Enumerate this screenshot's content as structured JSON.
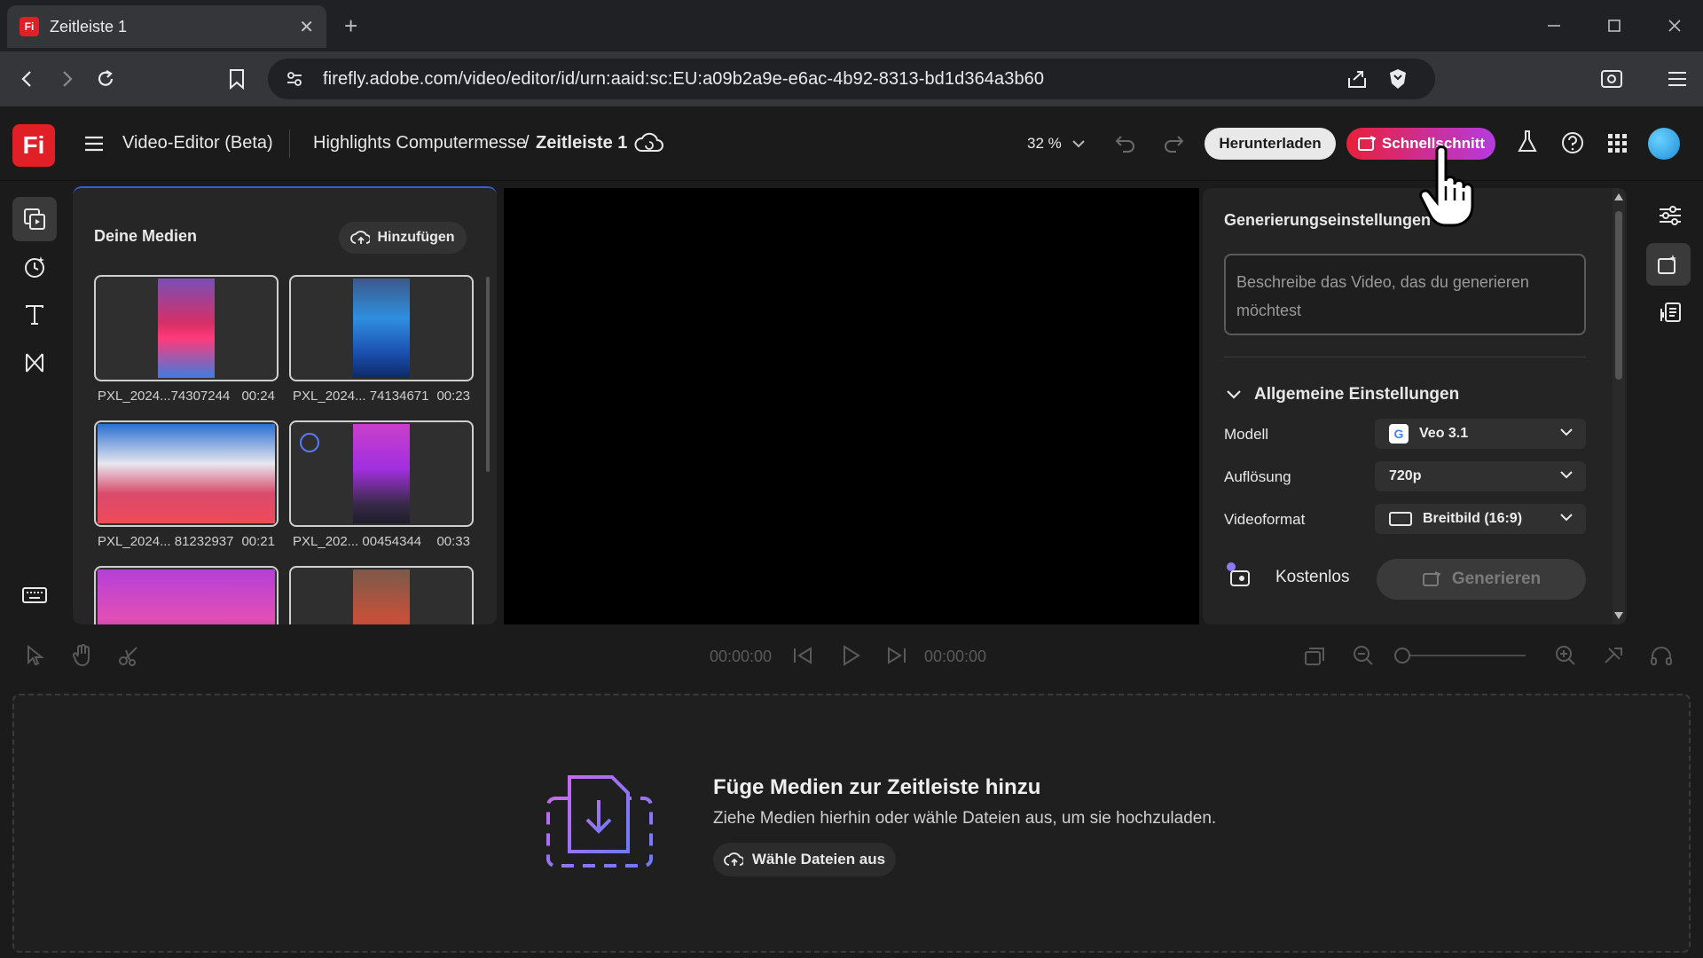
{
  "browser": {
    "tab_title": "Zeitleiste 1",
    "tab_favicon": "Fi",
    "url": "firefly.adobe.com/video/editor/id/urn:aaid:sc:EU:a09b2a9e-e6ac-4b92-8313-bd1d364a3b60"
  },
  "header": {
    "logo": "Fi",
    "app_name": "Video-Editor (Beta)",
    "project": "Highlights Computermesse",
    "separator": "/",
    "timeline_name": "Zeitleiste 1",
    "zoom": "32 %",
    "download_label": "Herunterladen",
    "quickcut_label": "Schnellschnitt"
  },
  "media": {
    "title": "Deine Medien",
    "add_label": "Hinzufügen",
    "items": [
      {
        "name": "PXL_2024...74307244",
        "duration": "00:24"
      },
      {
        "name": "PXL_2024... 74134671",
        "duration": "00:23"
      },
      {
        "name": "PXL_2024... 81232937",
        "duration": "00:21"
      },
      {
        "name": "PXL_202... 00454344",
        "duration": "00:33"
      }
    ]
  },
  "generation": {
    "title": "Generierungseinstellungen",
    "prompt_placeholder": "Beschreibe das Video, das du generieren möchtest",
    "section_title": "Allgemeine Einstellungen",
    "model_label": "Modell",
    "model_value": "Veo 3.1",
    "resolution_label": "Auflösung",
    "resolution_value": "720p",
    "format_label": "Videoformat",
    "format_value": "Breitbild (16:9)",
    "cost_label": "Kostenlos",
    "generate_label": "Generieren"
  },
  "transport": {
    "current_time": "00:00:00",
    "total_time": "00:00:00",
    "zoom_level": 0.0
  },
  "timeline": {
    "empty_title": "Füge Medien zur Zeitleiste hinzu",
    "empty_subtitle": "Ziehe Medien hierhin oder wähle Dateien aus, um sie hochzuladen.",
    "choose_files_label": "Wähle Dateien aus"
  },
  "colors": {
    "brand_red": "#e01f26",
    "quickcut_gradient_start": "#e8203a",
    "quickcut_gradient_end": "#b53be0",
    "accent_blue": "#3a5ec9"
  }
}
